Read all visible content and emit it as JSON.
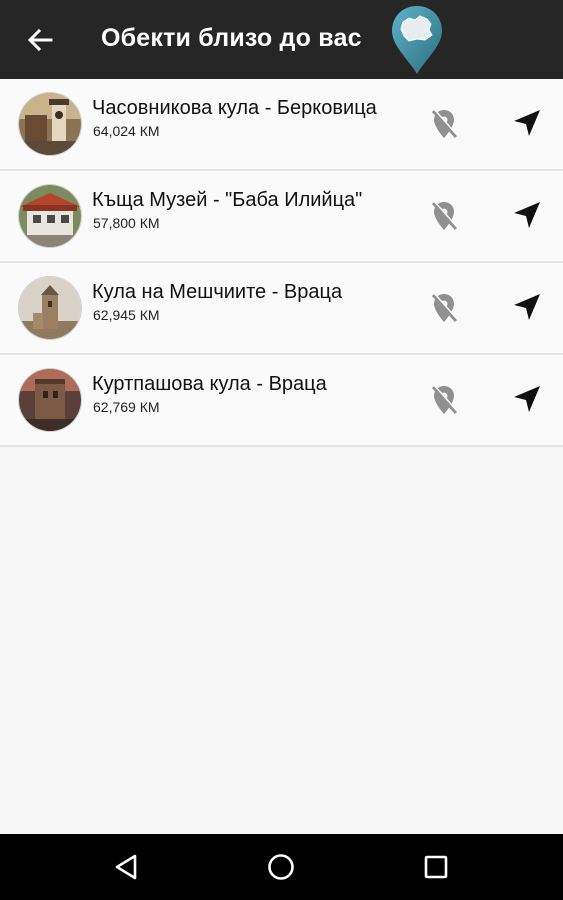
{
  "app_bar": {
    "title": "Обекти близо до вас",
    "back_icon": "arrow-left-icon",
    "logo_icon": "bulgaria-map-pin-logo",
    "background": "#262626",
    "logo_color": "#3f8fa2"
  },
  "places": [
    {
      "title": "Часовникова кула - Берковица",
      "distance": "64,024 КМ",
      "image": "clock-tower-photo",
      "visited_icon": "location-off-icon",
      "navigate_icon": "navigation-arrow-icon"
    },
    {
      "title": "Къща Музей - \"Баба Илийца\"",
      "distance": "57,800 КМ",
      "image": "museum-house-photo",
      "visited_icon": "location-off-icon",
      "navigate_icon": "navigation-arrow-icon"
    },
    {
      "title": "Кула на Мешчиите - Враца",
      "distance": "62,945 КМ",
      "image": "meshchii-tower-photo",
      "visited_icon": "location-off-icon",
      "navigate_icon": "navigation-arrow-icon"
    },
    {
      "title": "Куртпашова кула - Враца",
      "distance": "62,769 КМ",
      "image": "kurtpasha-tower-photo",
      "visited_icon": "location-off-icon",
      "navigate_icon": "navigation-arrow-icon"
    }
  ],
  "system_nav": {
    "back_icon": "triangle-back-icon",
    "home_icon": "circle-home-icon",
    "recents_icon": "square-recents-icon"
  }
}
